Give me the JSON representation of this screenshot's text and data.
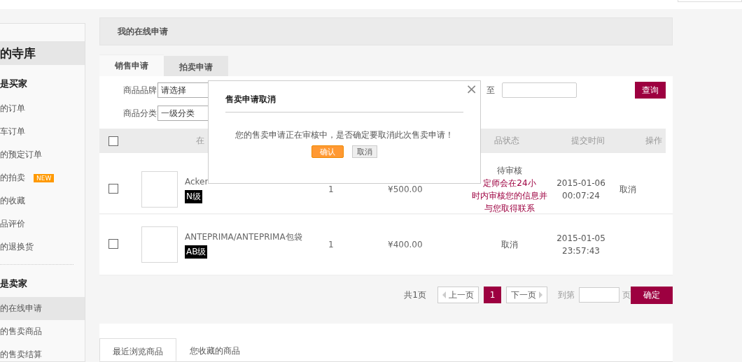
{
  "sidebar": {
    "title": "的寺库",
    "sections": [
      {
        "heading": "是买家",
        "items": [
          {
            "label": "的订单",
            "selected": false
          },
          {
            "label": "车订单",
            "selected": false
          },
          {
            "label": "的预定订单",
            "selected": false
          },
          {
            "label": "的拍卖",
            "selected": false,
            "badge": "NEW"
          },
          {
            "label": "的收藏",
            "selected": false
          },
          {
            "label": "品评价",
            "selected": false
          },
          {
            "label": "的退换货",
            "selected": false
          }
        ]
      },
      {
        "heading": "是卖家",
        "items": [
          {
            "label": "的在线申请",
            "selected": true
          },
          {
            "label": "的售卖商品",
            "selected": false
          },
          {
            "label": "的售卖结算",
            "selected": false
          }
        ]
      }
    ]
  },
  "page_title": "我的在线申请",
  "tabs": [
    {
      "label": "销售申请",
      "selected": true
    },
    {
      "label": "拍卖申请",
      "selected": false
    }
  ],
  "filters": {
    "brand": {
      "label": "商品品牌",
      "value": "请选择"
    },
    "category": {
      "label": "商品分类",
      "value": "一级分类"
    },
    "to_label": "至",
    "query_button": "查询"
  },
  "table": {
    "all_checked": false,
    "columns": [
      "在",
      "品状态",
      "提交时间",
      "操作"
    ],
    "rows": [
      {
        "checked": false,
        "name": "Acker",
        "grade": "N级",
        "qty": "1",
        "price": "¥500.00",
        "status": "待审核",
        "note": [
          "定师会在24小",
          "时内审核您的信息并",
          "与您取得联系"
        ],
        "time": [
          "2015-01-06",
          "00:07:24"
        ],
        "action": "取消"
      },
      {
        "checked": false,
        "name": "ANTEPRIMA/ANTEPRIMA包袋",
        "grade": "AB级",
        "qty": "1",
        "price": "¥400.00",
        "status": "取消",
        "note": [],
        "time": [
          "2015-01-05",
          "23:57:43"
        ],
        "action": ""
      }
    ]
  },
  "pagination": {
    "total": "共1页",
    "prev": "上一页",
    "pages": [
      {
        "label": "1",
        "selected": true
      }
    ],
    "next": "下一页",
    "goto_label": "到第",
    "page_unit": "页",
    "confirm": "确定"
  },
  "bottom_tabs": [
    {
      "label": "最近浏览商品",
      "selected": true
    },
    {
      "label": "您收藏的商品",
      "selected": false
    }
  ],
  "dialog": {
    "title": "售卖申请取消",
    "close": "×",
    "message": "您的售卖申请正在审核中，是否确定要取消此次售卖申请！",
    "confirm": "确认",
    "cancel": "取消"
  }
}
